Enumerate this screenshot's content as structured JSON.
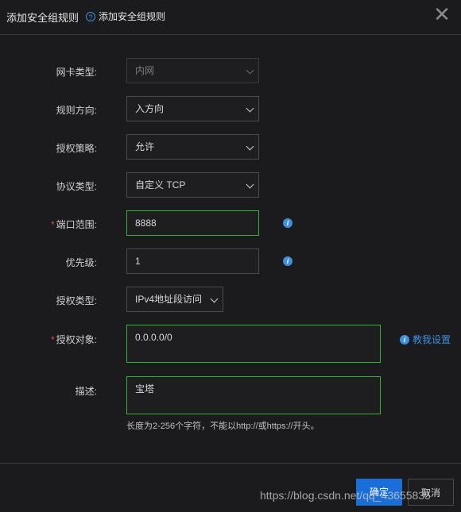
{
  "header": {
    "title": "添加安全组规则",
    "help_link": "添加安全组规则",
    "help_icon": "?"
  },
  "form": {
    "nic_type": {
      "label": "网卡类型:",
      "value": "内网"
    },
    "direction": {
      "label": "规则方向:",
      "value": "入方向"
    },
    "policy": {
      "label": "授权策略:",
      "value": "允许"
    },
    "protocol": {
      "label": "协议类型:",
      "value": "自定义 TCP"
    },
    "port_range": {
      "label": "端口范围:",
      "required": "*",
      "value": "8888"
    },
    "priority": {
      "label": "优先级:",
      "value": "1"
    },
    "auth_type": {
      "label": "授权类型:",
      "value": "IPv4地址段访问"
    },
    "auth_object": {
      "label": "授权对象:",
      "required": "*",
      "value": "0.0.0.0/0",
      "guide_link": "教我设置"
    },
    "description": {
      "label": "描述:",
      "value": "宝塔",
      "hint": "长度为2-256个字符，不能以http://或https://开头。"
    }
  },
  "footer": {
    "ok_label": "确定",
    "cancel_label": "取消"
  },
  "watermark": "https://blog.csdn.net/qq_43655835",
  "colors": {
    "accent": "#3d8fe0",
    "valid_border": "#36b336",
    "required": "#e54545",
    "primary_button": "#1a6ed8"
  }
}
